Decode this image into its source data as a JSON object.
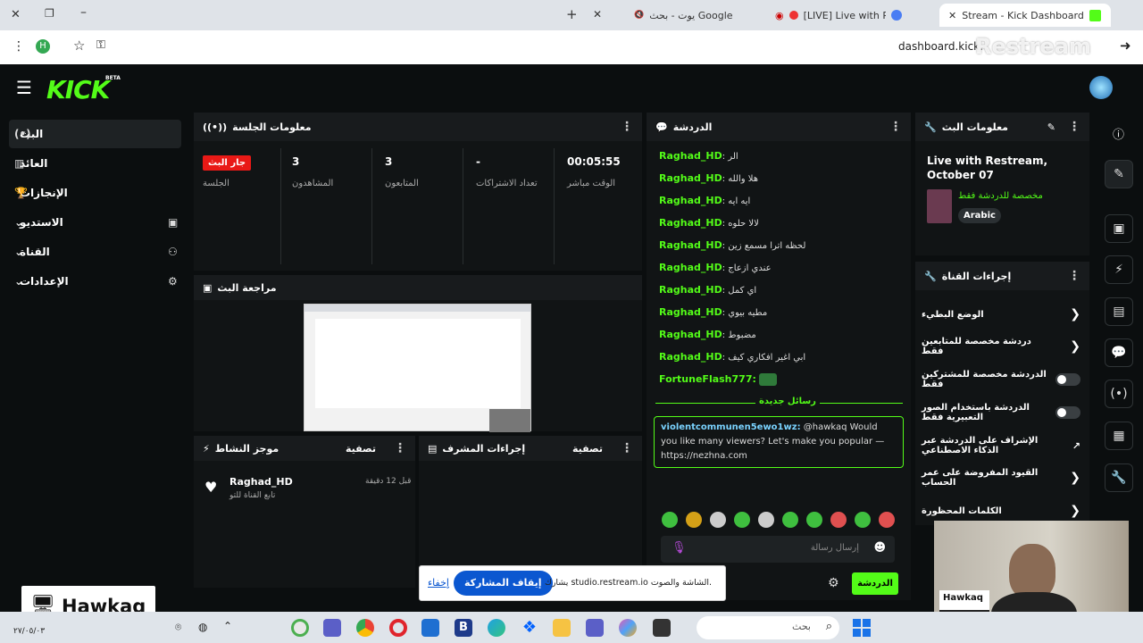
{
  "browser": {
    "tabs": [
      {
        "label": "يوت - بحث Google"
      },
      {
        "label": "[LIVE] Live with Restream"
      },
      {
        "label": "Stream - Kick Dashboard"
      }
    ],
    "url": "dashboard.kick.c",
    "watermark": "Restream"
  },
  "kick": {
    "logo": "KICK",
    "beta": "BETA"
  },
  "nav": {
    "items": [
      {
        "label": "البث"
      },
      {
        "label": "العائد"
      },
      {
        "label": "الإنجازات"
      },
      {
        "label": "الاستديو"
      },
      {
        "label": "القناة"
      },
      {
        "label": "الإعدادات"
      }
    ]
  },
  "session": {
    "title": "معلومات الجلسة",
    "live_badge": "جار البث",
    "session_label": "الجلسة",
    "stats": [
      {
        "value": "3",
        "label": "المشاهدون"
      },
      {
        "value": "3",
        "label": "المتابعون"
      },
      {
        "value": "-",
        "label": "تعداد الاشتراكات"
      },
      {
        "value": "00:05:55",
        "label": "الوقت مباشر"
      }
    ]
  },
  "preview": {
    "title": "مراجعة البث"
  },
  "activity": {
    "title": "موجز النشاط",
    "filter": "تصفية",
    "item_user": "Raghad_HD",
    "item_text": "تابع القناة للتو",
    "item_time": "قبل 12 دقيقة"
  },
  "modactions": {
    "title": "إجراءات المشرف",
    "filter": "تصفية"
  },
  "chat": {
    "title": "الدردشة",
    "messages": [
      {
        "user": "Raghad_HD",
        "text": "الر"
      },
      {
        "user": "Raghad_HD",
        "text": "هلا والله"
      },
      {
        "user": "Raghad_HD",
        "text": "ايه ايه"
      },
      {
        "user": "Raghad_HD",
        "text": "لالا حلوه"
      },
      {
        "user": "Raghad_HD",
        "text": "لحظه اترا مسمع زين"
      },
      {
        "user": "Raghad_HD",
        "text": "عندي ازعاج"
      },
      {
        "user": "Raghad_HD",
        "text": "اي كمل"
      },
      {
        "user": "Raghad_HD",
        "text": "مطيه بيوي"
      },
      {
        "user": "Raghad_HD",
        "text": "مضبوط"
      },
      {
        "user": "Raghad_HD",
        "text": "ابي اغير افكاري كيف"
      }
    ],
    "last_user": "FortuneFlash777:",
    "new_messages": "رسائل جديدة",
    "pinned_user": "violentcommunen5ewo1wz:",
    "pinned_text": "@hawkaq Would you like many viewers? Let's make you popular — https://nezhna.com",
    "input_placeholder": "إرسال رسالة",
    "send_label": "الدردشة"
  },
  "streaminfo": {
    "title": "معلومات البث",
    "stream_title": "Live with Restream, October 07",
    "category": "مخصصة للدردشة فقط",
    "language": "Arabic"
  },
  "channelactions": {
    "title": "إجراءات القناة",
    "rows": [
      {
        "label": "الوضع البطيء",
        "kind": "chevron"
      },
      {
        "label": "دردشة مخصصة للمتابعين فقط",
        "kind": "chevron"
      },
      {
        "label": "الدردشة مخصصة للمشتركين فقط",
        "kind": "toggle"
      },
      {
        "label": "الدردشة باستخدام الصور التعبيرية فقط",
        "kind": "toggle"
      },
      {
        "label": "الإشراف على الدردشة عبر الذكاء الاصطناعي",
        "kind": "external"
      },
      {
        "label": "القيود المفروضة على عمر الحساب",
        "kind": "chevron"
      },
      {
        "label": "الكلمات المحظورة",
        "kind": "chevron"
      }
    ]
  },
  "share_bar": {
    "text": "يشارك studio.restream.io الشاشة والصوت.",
    "stop": "إيقاف المشاركة",
    "hide": "إخفاء"
  },
  "overlay": {
    "name": "Hawkaq",
    "cam_name": "Hawkaq",
    "cam_sub": "aq"
  },
  "taskbar": {
    "search": "بحث",
    "date": "٢٧/٠٥/٠٣"
  },
  "colors": {
    "accent": "#53fc18",
    "live": "#e91916",
    "share_blue": "#0b57d0"
  }
}
